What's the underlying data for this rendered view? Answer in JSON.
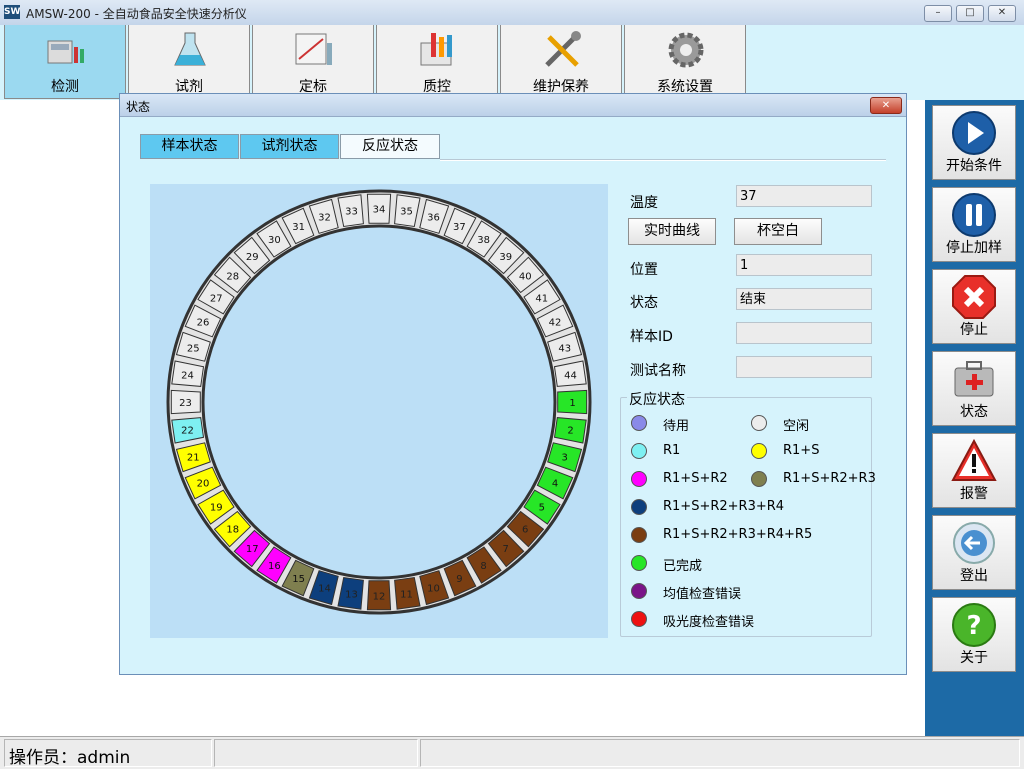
{
  "window": {
    "icon_text": "SW",
    "title": "AMSW-200 - 全自动食品安全快速分析仪"
  },
  "toolbar": {
    "tabs": [
      {
        "label": "检测",
        "icon": "detect-icon"
      },
      {
        "label": "试剂",
        "icon": "reagent-icon"
      },
      {
        "label": "定标",
        "icon": "calibrate-icon"
      },
      {
        "label": "质控",
        "icon": "quality-control-icon"
      },
      {
        "label": "维护保养",
        "icon": "maintenance-icon"
      },
      {
        "label": "系统设置",
        "icon": "settings-icon"
      }
    ]
  },
  "side": {
    "buttons": [
      {
        "label": "开始条件",
        "icon": "play-icon"
      },
      {
        "label": "停止加样",
        "icon": "pause-icon"
      },
      {
        "label": "停止",
        "icon": "stop-icon"
      },
      {
        "label": "状态",
        "icon": "first-aid-icon"
      },
      {
        "label": "报警",
        "icon": "warning-icon"
      },
      {
        "label": "登出",
        "icon": "logout-icon"
      },
      {
        "label": "关于",
        "icon": "help-icon"
      }
    ]
  },
  "status_bar": {
    "operator": "操作员：admin"
  },
  "dialog": {
    "title": "状态",
    "tabs": [
      "样本状态",
      "试剂状态",
      "反应状态"
    ],
    "active_tab": "反应状态",
    "fields": {
      "temperature": {
        "label": "温度",
        "value": "37"
      },
      "position": {
        "label": "位置",
        "value": "1"
      },
      "state": {
        "label": "状态",
        "value": "结束"
      },
      "sample_id": {
        "label": "样本ID",
        "value": ""
      },
      "test_name": {
        "label": "测试名称",
        "value": ""
      }
    },
    "buttons": {
      "realtime_curve": "实时曲线",
      "cup_blank": "杯空白"
    },
    "legend": {
      "title": "反应状态",
      "items": [
        {
          "label": "待用",
          "color": "#8a8ae8"
        },
        {
          "label": "空闲",
          "color": "#ececec"
        },
        {
          "label": "R1",
          "color": "#7ef0f2"
        },
        {
          "label": "R1+S",
          "color": "#ffff00"
        },
        {
          "label": "R1+S+R2",
          "color": "#ff00ff"
        },
        {
          "label": "R1+S+R2+R3",
          "color": "#7f7f4f"
        },
        {
          "label": "R1+S+R2+R3+R4",
          "color": "#0d3f7d"
        },
        {
          "label": "R1+S+R2+R3+R4+R5",
          "color": "#7a3e12"
        },
        {
          "label": "已完成",
          "color": "#27e627"
        },
        {
          "label": "均值检查错误",
          "color": "#7a1488"
        },
        {
          "label": "吸光度检查错误",
          "color": "#ee1111"
        }
      ]
    },
    "cuvettes": [
      {
        "n": "1",
        "state": "已完成"
      },
      {
        "n": "2",
        "state": "已完成"
      },
      {
        "n": "3",
        "state": "已完成"
      },
      {
        "n": "4",
        "state": "已完成"
      },
      {
        "n": "5",
        "state": "已完成"
      },
      {
        "n": "6",
        "state": "R1+S+R2+R3+R4+R5"
      },
      {
        "n": "7",
        "state": "R1+S+R2+R3+R4+R5"
      },
      {
        "n": "8",
        "state": "R1+S+R2+R3+R4+R5"
      },
      {
        "n": "9",
        "state": "R1+S+R2+R3+R4+R5"
      },
      {
        "n": "10",
        "state": "R1+S+R2+R3+R4+R5"
      },
      {
        "n": "11",
        "state": "R1+S+R2+R3+R4+R5"
      },
      {
        "n": "12",
        "state": "R1+S+R2+R3+R4+R5"
      },
      {
        "n": "13",
        "state": "R1+S+R2+R3+R4"
      },
      {
        "n": "14",
        "state": "R1+S+R2+R3+R4"
      },
      {
        "n": "15",
        "state": "R1+S+R2+R3"
      },
      {
        "n": "16",
        "state": "R1+S+R2"
      },
      {
        "n": "17",
        "state": "R1+S+R2"
      },
      {
        "n": "18",
        "state": "R1+S"
      },
      {
        "n": "19",
        "state": "R1+S"
      },
      {
        "n": "20",
        "state": "R1+S"
      },
      {
        "n": "21",
        "state": "R1+S"
      },
      {
        "n": "22",
        "state": "R1"
      },
      {
        "n": "23",
        "state": "空闲"
      },
      {
        "n": "24",
        "state": "空闲"
      },
      {
        "n": "25",
        "state": "空闲"
      },
      {
        "n": "26",
        "state": "空闲"
      },
      {
        "n": "27",
        "state": "空闲"
      },
      {
        "n": "28",
        "state": "空闲"
      },
      {
        "n": "29",
        "state": "空闲"
      },
      {
        "n": "30",
        "state": "空闲"
      },
      {
        "n": "31",
        "state": "空闲"
      },
      {
        "n": "32",
        "state": "空闲"
      },
      {
        "n": "33",
        "state": "空闲"
      },
      {
        "n": "34",
        "state": "空闲"
      },
      {
        "n": "35",
        "state": "空闲"
      },
      {
        "n": "36",
        "state": "空闲"
      },
      {
        "n": "37",
        "state": "空闲"
      },
      {
        "n": "38",
        "state": "空闲"
      },
      {
        "n": "39",
        "state": "空闲"
      },
      {
        "n": "40",
        "state": "空闲"
      },
      {
        "n": "41",
        "state": "空闲"
      },
      {
        "n": "42",
        "state": "空闲"
      },
      {
        "n": "43",
        "state": "空闲"
      },
      {
        "n": "44",
        "state": "空闲"
      }
    ]
  }
}
